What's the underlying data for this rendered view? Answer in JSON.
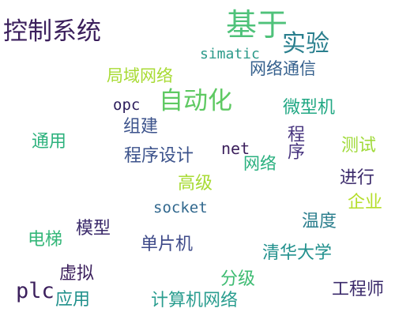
{
  "words": [
    {
      "text": "控制系统",
      "color": "#3b1f5c"
    },
    {
      "text": "基于",
      "color": "#4fc27a"
    },
    {
      "text": "实验",
      "color": "#2a7f8e"
    },
    {
      "text": "simatic",
      "color": "#2c9a8a"
    },
    {
      "text": "网络通信",
      "color": "#35608d"
    },
    {
      "text": "局域网络",
      "color": "#a8db34"
    },
    {
      "text": "opc",
      "color": "#2c1d5c"
    },
    {
      "text": "自动化",
      "color": "#5ec962"
    },
    {
      "text": "微型机",
      "color": "#22a884"
    },
    {
      "text": "组建",
      "color": "#3b528b"
    },
    {
      "text": "程序",
      "color": "#46337e"
    },
    {
      "text": "通用",
      "color": "#2db27d"
    },
    {
      "text": "测试",
      "color": "#a0da39"
    },
    {
      "text": "net",
      "color": "#3b1f5c"
    },
    {
      "text": "程序设计",
      "color": "#3b528b"
    },
    {
      "text": "网络",
      "color": "#2ab07f"
    },
    {
      "text": "进行",
      "color": "#3b2a6b"
    },
    {
      "text": "高级",
      "color": "#a8db34"
    },
    {
      "text": "企业",
      "color": "#b5de2b"
    },
    {
      "text": "socket",
      "color": "#31688e"
    },
    {
      "text": "温度",
      "color": "#2c7f8e"
    },
    {
      "text": "模型",
      "color": "#3b2a6b"
    },
    {
      "text": "电梯",
      "color": "#35b779"
    },
    {
      "text": "单片机",
      "color": "#3e4a89"
    },
    {
      "text": "清华大学",
      "color": "#21908d"
    },
    {
      "text": "虚拟",
      "color": "#3b1f5c"
    },
    {
      "text": "分级",
      "color": "#3fbc73"
    },
    {
      "text": "plc",
      "color": "#3b1f5c"
    },
    {
      "text": "应用",
      "color": "#21918c"
    },
    {
      "text": "计算机网络",
      "color": "#2a9d8f"
    },
    {
      "text": "工程师",
      "color": "#3b2a6b"
    }
  ]
}
